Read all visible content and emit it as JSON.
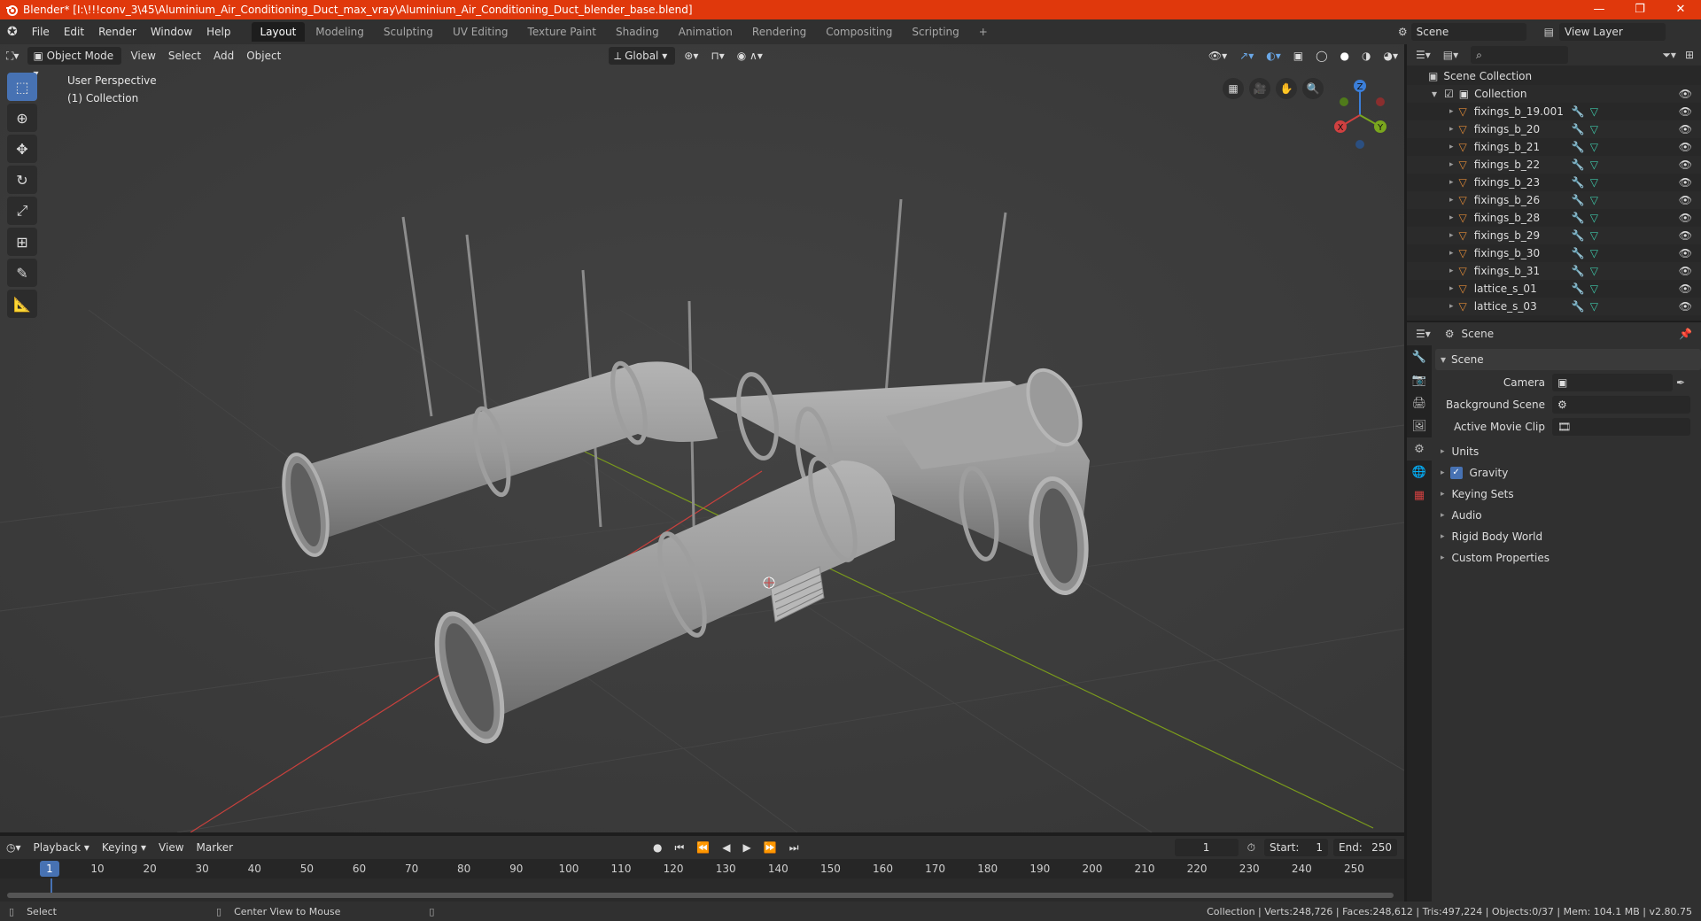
{
  "titlebar": {
    "title": "Blender* [I:\\!!!conv_3\\45\\Aluminium_Air_Conditioning_Duct_max_vray\\Aluminium_Air_Conditioning_Duct_blender_base.blend]",
    "minimize": "—",
    "maximize": "❐",
    "close": "✕"
  },
  "menu": {
    "items": [
      "File",
      "Edit",
      "Render",
      "Window",
      "Help"
    ]
  },
  "workspaces": [
    "Layout",
    "Modeling",
    "Sculpting",
    "UV Editing",
    "Texture Paint",
    "Shading",
    "Animation",
    "Rendering",
    "Compositing",
    "Scripting"
  ],
  "workspace_add": "+",
  "scene_field": "Scene",
  "view_layer_field": "View Layer",
  "viewport_header": {
    "mode": "Object Mode",
    "view": "View",
    "select": "Select",
    "add": "Add",
    "object": "Object",
    "orientation": "Global"
  },
  "viewport": {
    "perspective": "User Perspective",
    "collection": "(1) Collection",
    "gizmo_x": "X",
    "gizmo_y": "Y",
    "gizmo_z": "Z"
  },
  "outliner": {
    "root": "Scene Collection",
    "collection": "Collection",
    "items": [
      {
        "name": "fixings_b_19.001"
      },
      {
        "name": "fixings_b_20"
      },
      {
        "name": "fixings_b_21"
      },
      {
        "name": "fixings_b_22"
      },
      {
        "name": "fixings_b_23"
      },
      {
        "name": "fixings_b_26"
      },
      {
        "name": "fixings_b_28"
      },
      {
        "name": "fixings_b_29"
      },
      {
        "name": "fixings_b_30"
      },
      {
        "name": "fixings_b_31"
      },
      {
        "name": "lattice_s_01"
      },
      {
        "name": "lattice_s_03"
      }
    ]
  },
  "properties": {
    "header_scene": "Scene",
    "panel_title": "Scene",
    "camera_label": "Camera",
    "background_scene_label": "Background Scene",
    "active_movie_clip_label": "Active Movie Clip",
    "sections": [
      "Units",
      "Gravity",
      "Keying Sets",
      "Audio",
      "Rigid Body World",
      "Custom Properties"
    ]
  },
  "timeline": {
    "playback": "Playback",
    "keying": "Keying",
    "view": "View",
    "marker": "Marker",
    "current_frame": "1",
    "start_label": "Start:",
    "start_value": "1",
    "end_label": "End:",
    "end_value": "250",
    "ruler_current": "1",
    "ticks": [
      "10",
      "20",
      "30",
      "40",
      "50",
      "60",
      "70",
      "80",
      "90",
      "100",
      "110",
      "120",
      "130",
      "140",
      "150",
      "160",
      "170",
      "180",
      "190",
      "200",
      "210",
      "220",
      "230",
      "240",
      "250"
    ]
  },
  "statusbar": {
    "select": "Select",
    "center_view": "Center View to Mouse",
    "stats": "Collection | Verts:248,726 | Faces:248,612 | Tris:497,224 | Objects:0/37 | Mem: 104.1 MB | v2.80.75"
  },
  "colors": {
    "titlebar": "#e0380c",
    "accent": "#4772b3",
    "viewport_bg": "#3d3d3d",
    "axis_red": "#c8413d",
    "axis_green": "#7a9a1c",
    "mesh_icon": "#e08a37",
    "modifier_icon": "#6aa7e6",
    "data_icon": "#3ec7a8"
  }
}
